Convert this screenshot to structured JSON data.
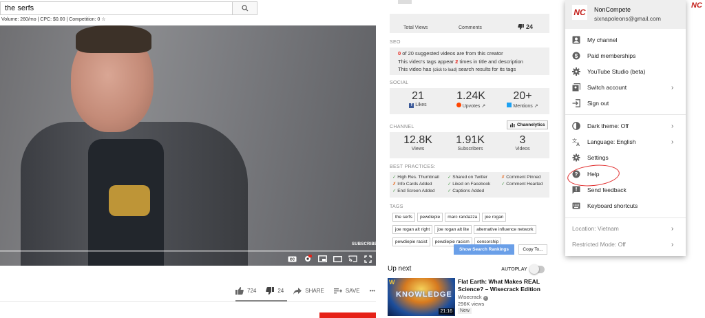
{
  "search": {
    "query": "the serfs",
    "keyword_stats": "Volume: 260/mo | CPC: $0.00 | Competition: 0"
  },
  "video": {
    "subscribe_watermark": "SUBSCRIBE"
  },
  "actions": {
    "likes": "724",
    "dislikes": "24",
    "share": "SHARE",
    "save": "SAVE",
    "more": "•••"
  },
  "ext": {
    "top_stats": {
      "views_label": "Total Views",
      "comments_label": "Comments",
      "dislikes": "24"
    },
    "seo": {
      "title": "SEO",
      "line1_count": "0",
      "line1_rest": " of 20 suggested videos are from this creator",
      "line2_pre": "This video's tags appear ",
      "line2_count": "2",
      "line2_post": " times in title and description",
      "line3_pre": "This video has ",
      "line3_link": "(click to load)",
      "line3_post": " search results for its tags"
    },
    "social": {
      "title": "SOCIAL",
      "likes": "21",
      "likes_label": "Likes",
      "upvotes": "1.24K",
      "upvotes_label": "Upvotes",
      "mentions": "20+",
      "mentions_label": "Mentions"
    },
    "channel": {
      "title": "CHANNEL",
      "button": "Channelytics",
      "views": "12.8K",
      "views_label": "Views",
      "subs": "1.91K",
      "subs_label": "Subscribers",
      "videos": "3",
      "videos_label": "Videos"
    },
    "best_practices": {
      "title": "BEST PRACTICES:",
      "items": [
        {
          "mark": "✓",
          "ok": true,
          "text": "High Res. Thumbnail"
        },
        {
          "mark": "✓",
          "ok": true,
          "text": "Shared on Twitter"
        },
        {
          "mark": "✗",
          "ok": false,
          "text": "Comment Pinned"
        },
        {
          "mark": "✗",
          "ok": false,
          "text": "Info Cards Added"
        },
        {
          "mark": "✓",
          "ok": true,
          "text": "Liked on Facebook"
        },
        {
          "mark": "✓",
          "ok": true,
          "text": "Comment Hearted"
        },
        {
          "mark": "✓",
          "ok": true,
          "text": "End Screen Added"
        },
        {
          "mark": "✓",
          "ok": true,
          "text": "Captions Added"
        }
      ]
    },
    "tags": {
      "title": "TAGS",
      "items": [
        "the serfs",
        "pewdiepie",
        "marc randazza",
        "joe rogan",
        "joe rogan alt right",
        "joe rogan alt lite",
        "alternative influence network",
        "pewdiepie racist",
        "pewdiepie racism",
        "censorship"
      ],
      "show_rankings": "Show Search Rankings",
      "copy": "Copy To..."
    }
  },
  "upnext": {
    "heading": "Up next",
    "autoplay": "AUTOPLAY",
    "title": "Flat Earth: What Makes REAL Science? – Wisecrack Edition",
    "channel": "Wisecrack",
    "views": "296K views",
    "badge": "New",
    "duration": "21:16",
    "thumb_text": "KNOWLEDGE"
  },
  "menu": {
    "name": "NonCompete",
    "email": "sixnapoleons@gmail.com",
    "avatar": "NC",
    "items": {
      "my_channel": "My channel",
      "paid": "Paid memberships",
      "studio": "YouTube Studio (beta)",
      "switch": "Switch account",
      "signout": "Sign out",
      "dark": "Dark theme: Off",
      "language": "Language: English",
      "settings": "Settings",
      "help": "Help",
      "feedback": "Send feedback",
      "shortcuts": "Keyboard shortcuts",
      "location": "Location: Vietnam",
      "restricted": "Restricted Mode: Off"
    }
  },
  "colors": {
    "red": "#e62117",
    "blue_button": "#6a9fe8",
    "check": "#4a9a4a",
    "cross": "#e66a1f"
  }
}
